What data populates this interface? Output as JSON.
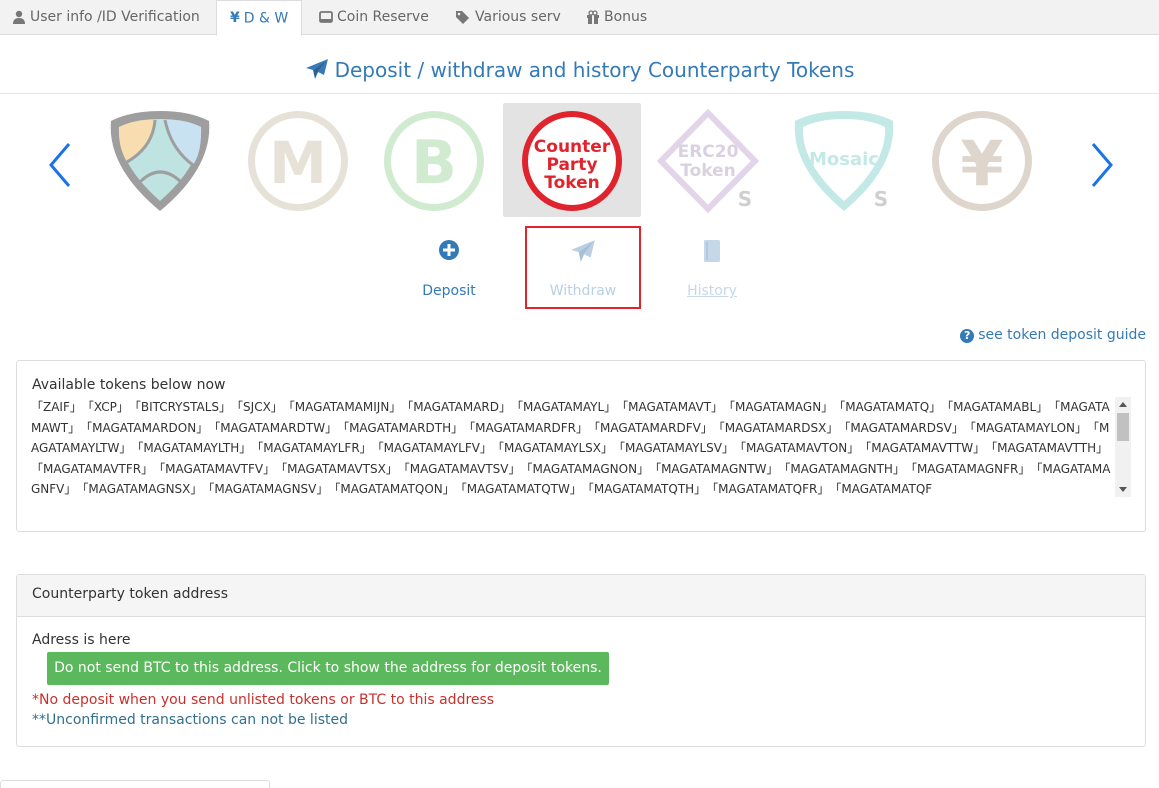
{
  "tabs": [
    {
      "label": "User info /ID Verification",
      "icon": "user-icon"
    },
    {
      "label": "D & W",
      "icon": "yen-icon",
      "active": true
    },
    {
      "label": "Coin Reserve",
      "icon": "hdd-icon"
    },
    {
      "label": "Various serv",
      "icon": "tags-icon"
    },
    {
      "label": "Bonus",
      "icon": "gift-icon"
    }
  ],
  "title": "Deposit / withdraw and history Counterparty Tokens",
  "carousel": {
    "coins": [
      {
        "name": "nem-coin"
      },
      {
        "name": "monacoin-coin",
        "glyph": "M"
      },
      {
        "name": "bitcoin-coin",
        "glyph": "B"
      },
      {
        "name": "counterparty-token-coin",
        "lines": [
          "Counter",
          "Party",
          "Token"
        ],
        "selected": true
      },
      {
        "name": "erc20-token-coin",
        "lines": [
          "ERC20",
          "Token"
        ]
      },
      {
        "name": "mosaic-coin",
        "lines": [
          "Mosaic"
        ]
      },
      {
        "name": "yen-coin",
        "glyph": "¥"
      }
    ]
  },
  "actions": {
    "deposit": "Deposit",
    "withdraw": "Withdraw",
    "history": "History"
  },
  "guide_link": "see token deposit guide",
  "tokens": {
    "heading": "Available tokens below now",
    "list": "「ZAIF」　「XCP」　「BITCRYSTALS」　「SJCX」　「MAGATAMAMIJN」　「MAGATAMARD」　「MAGATAMAYL」　「MAGATAMAVT」　「MAGATAMAGN」　「MAGATAMATQ」　「MAGATAMABL」　「MAGATAMAWT」　「MAGATAMARDON」　「MAGATAMARDTW」　「MAGATAMARDTH」　「MAGATAMARDFR」　「MAGATAMARDFV」　「MAGATAMARDSX」　「MAGATAMARDSV」　「MAGATAMAYLON」　「MAGATAMAYLTW」　「MAGATAMAYLTH」　「MAGATAMAYLFR」　「MAGATAMAYLFV」　「MAGATAMAYLSX」　「MAGATAMAYLSV」　「MAGATAMAVTON」　「MAGATAMAVTTW」　「MAGATAMAVTTH」　「MAGATAMAVTFR」　「MAGATAMAVTFV」　「MAGATAMAVTSX」　「MAGATAMAVTSV」　「MAGATAMAGNON」　「MAGATAMAGNTW」　「MAGATAMAGNTH」　「MAGATAMAGNFR」　「MAGATAMAGNFV」　「MAGATAMAGNSX」　「MAGATAMAGNSV」　「MAGATAMATQON」　「MAGATAMATQTW」　「MAGATAMATQTH」　「MAGATAMATQFR」　「MAGATAMATQF"
  },
  "address_panel": {
    "heading": "Counterparty token address",
    "address_label": "Adress is here",
    "show_button": "Do not send BTC to this address. Click to show the address for deposit tokens.",
    "warning": "*No deposit when you send unlisted tokens or BTC to this address",
    "note": "**Unconfirmed transactions can not be listed"
  },
  "colors": {
    "accent": "#337ab7",
    "selected_box": "#e0252d",
    "green_button": "#5cb85c",
    "warning": "#c9302c"
  }
}
